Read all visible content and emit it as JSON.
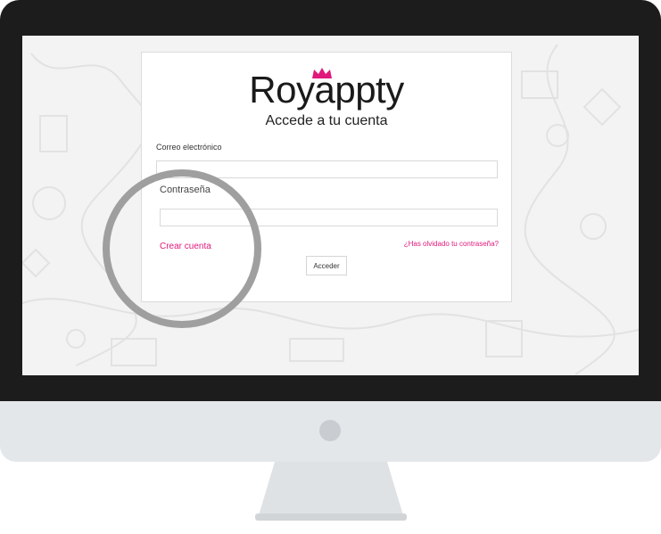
{
  "brand": {
    "name": "Royappty",
    "accent_color": "#e0197b",
    "crown_icon": "crown-icon"
  },
  "login": {
    "title": "Accede a tu cuenta",
    "email_label": "Correo electrónico",
    "email_value": "",
    "password_label": "Contraseña",
    "password_value": "",
    "create_account_link": "Crear cuenta",
    "forgot_password_link": "¿Has olvidado tu contraseña?",
    "submit_label": "Acceder"
  },
  "device": {
    "type": "desktop-monitor",
    "bezel_color": "#1c1c1c",
    "chin_color": "#e4e7ea"
  }
}
